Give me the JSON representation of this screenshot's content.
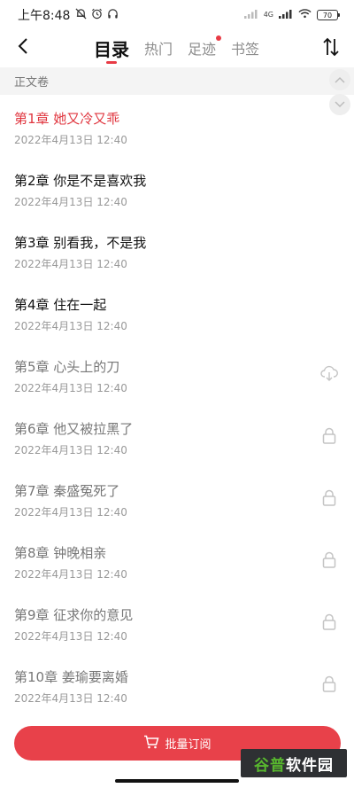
{
  "status_bar": {
    "time": "上午8:48",
    "network": "4G",
    "battery": "70"
  },
  "nav": {
    "tabs": [
      {
        "label": "目录",
        "active": true,
        "dot": false
      },
      {
        "label": "热门",
        "active": false,
        "dot": false
      },
      {
        "label": "足迹",
        "active": false,
        "dot": true
      },
      {
        "label": "书签",
        "active": false,
        "dot": false
      }
    ]
  },
  "volume_title": "正文卷",
  "chapters": [
    {
      "title": "第1章 她又冷又乖",
      "date": "2022年4月13日 12:40",
      "state": "current",
      "icon": ""
    },
    {
      "title": "第2章 你是不是喜欢我",
      "date": "2022年4月13日 12:40",
      "state": "read",
      "icon": ""
    },
    {
      "title": "第3章 别看我，不是我",
      "date": "2022年4月13日 12:40",
      "state": "read",
      "icon": ""
    },
    {
      "title": "第4章 住在一起",
      "date": "2022年4月13日 12:40",
      "state": "read",
      "icon": ""
    },
    {
      "title": "第5章 心头上的刀",
      "date": "2022年4月13日 12:40",
      "state": "locked",
      "icon": "cloud-download-icon"
    },
    {
      "title": "第6章 他又被拉黑了",
      "date": "2022年4月13日 12:40",
      "state": "locked",
      "icon": "lock-icon"
    },
    {
      "title": "第7章 秦盛冤死了",
      "date": "2022年4月13日 12:40",
      "state": "locked",
      "icon": "lock-icon"
    },
    {
      "title": "第8章 钟晚相亲",
      "date": "2022年4月13日 12:40",
      "state": "locked",
      "icon": "lock-icon"
    },
    {
      "title": "第9章 征求你的意见",
      "date": "2022年4月13日 12:40",
      "state": "locked",
      "icon": "lock-icon"
    },
    {
      "title": "第10章 姜瑜要离婚",
      "date": "2022年4月13日 12:40",
      "state": "locked",
      "icon": "lock-icon"
    }
  ],
  "subscribe_button": {
    "label": "批量订阅",
    "icon": "cart-icon",
    "color": "#e8414a"
  },
  "watermark": {
    "part1": "谷普",
    "part2": "软件园"
  },
  "colors": {
    "accent": "#e83b45",
    "current_chapter": "#e0363f"
  }
}
